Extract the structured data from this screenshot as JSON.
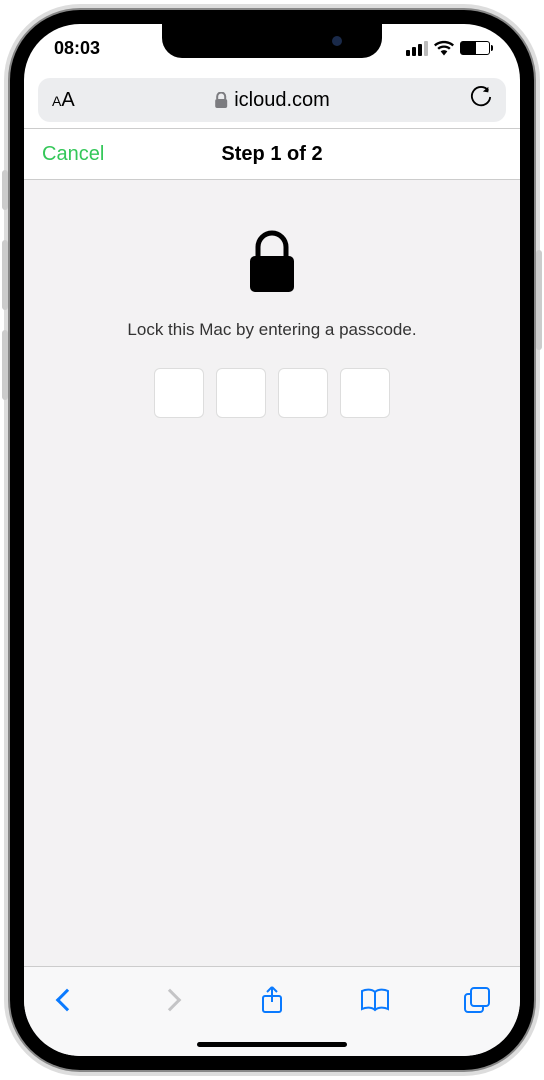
{
  "status": {
    "time": "08:03"
  },
  "urlbar": {
    "text_size_label": "A",
    "domain": "icloud.com"
  },
  "nav": {
    "cancel_label": "Cancel",
    "title": "Step 1 of 2"
  },
  "content": {
    "instruction": "Lock this Mac by entering a passcode."
  },
  "colors": {
    "accent_green": "#34c759",
    "accent_blue": "#0a7aff"
  }
}
